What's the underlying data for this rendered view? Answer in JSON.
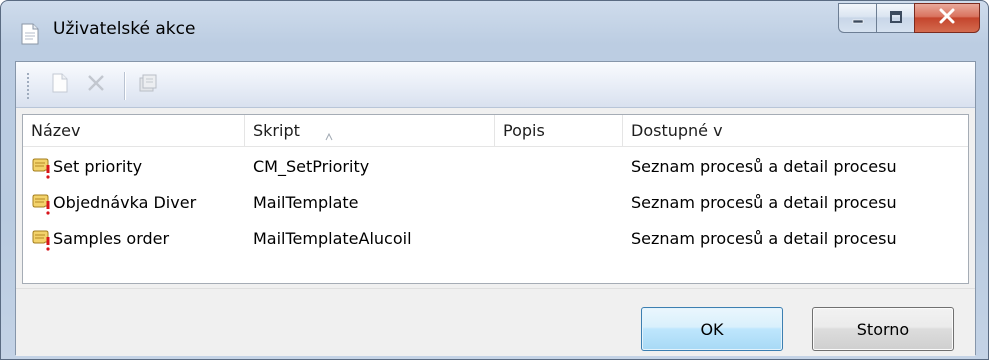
{
  "window": {
    "title": "Uživatelské akce",
    "icons": {
      "title": "document-icon",
      "minimize": "minimize-icon",
      "maximize": "maximize-icon",
      "close": "close-icon"
    }
  },
  "toolbar": {
    "icons": [
      "new-document-icon",
      "delete-icon",
      "properties-icon"
    ]
  },
  "list": {
    "columns": [
      {
        "label": "Název"
      },
      {
        "label": "Skript",
        "sort_indicator": "ascending"
      },
      {
        "label": "Popis"
      },
      {
        "label": "Dostupné v"
      }
    ],
    "rows": [
      {
        "name": "Set priority",
        "script": "CM_SetPriority",
        "description": "",
        "available_in": "Seznam procesů a detail procesu",
        "icon": "script-action-icon"
      },
      {
        "name": "Objednávka Diver",
        "script": "MailTemplate",
        "description": "",
        "available_in": "Seznam procesů a detail procesu",
        "icon": "script-action-icon"
      },
      {
        "name": "Samples order",
        "script": "MailTemplateAlucoil",
        "description": "",
        "available_in": "Seznam procesů a detail procesu",
        "icon": "script-action-icon"
      }
    ]
  },
  "footer": {
    "ok_label": "OK",
    "cancel_label": "Storno"
  },
  "colors": {
    "frame": "#b9cbe0",
    "close_button": "#c4452d",
    "default_button_border": "#3c7fb1"
  }
}
